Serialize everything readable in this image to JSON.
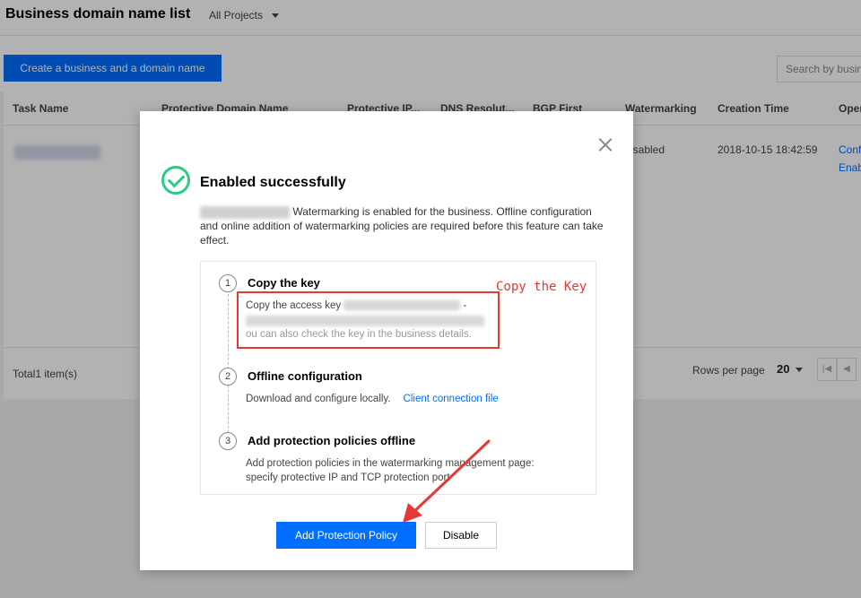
{
  "header": {
    "title": "Business domain name list",
    "project_select": "All Projects"
  },
  "toolbar": {
    "create_label": "Create a business and a domain name",
    "search_placeholder": "Search by busin"
  },
  "table": {
    "columns": [
      "Task Name",
      "Protective Domain Name",
      "Protective IP...",
      "DNS Resolut...",
      "BGP First",
      "Watermarking",
      "Creation Time",
      "Oper"
    ],
    "rows": [
      {
        "watermarking": "isabled",
        "creation_time": "2018-10-15 18:42:59",
        "op1": "Conf",
        "op2": "Enab"
      }
    ],
    "total": "Total1 item(s)",
    "rows_per_page_label": "Rows per page",
    "rows_per_page_value": "20"
  },
  "modal": {
    "title": "Enabled successfully",
    "desc_line1": "Watermarking is enabled for the business. Offline configuration",
    "desc_line2": "and online addition of watermarking policies are required before this feature can take",
    "desc_line3": "effect.",
    "steps": [
      {
        "num": "1",
        "title": "Copy the key",
        "text1": "Copy the access key",
        "text2": "-",
        "text3": "ou can also check the key in the business details."
      },
      {
        "num": "2",
        "title": "Offline configuration",
        "text1": "Download and configure locally.",
        "link": "Client connection file"
      },
      {
        "num": "3",
        "title": "Add protection policies offline",
        "text1": "Add protection policies in the watermarking management page:",
        "text2": "specify protective IP and TCP protection port"
      }
    ],
    "annotation": "Copy the Key",
    "primary_label": "Add Protection Policy",
    "secondary_label": "Disable"
  },
  "colors": {
    "primary": "#006eff",
    "success": "#29cc85",
    "annotation": "#e53935"
  }
}
